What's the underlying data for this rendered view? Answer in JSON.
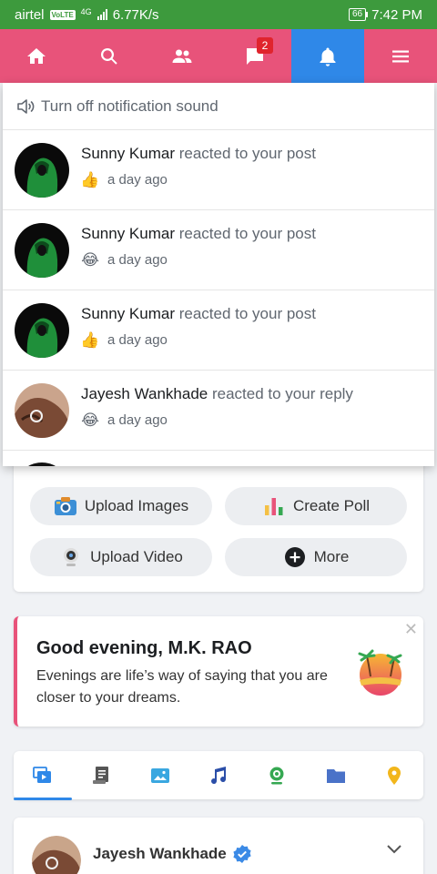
{
  "status_bar": {
    "carrier": "airtel",
    "volte": "VoLTE",
    "network": "4G",
    "speed": "6.77K/s",
    "battery": "66",
    "time": "7:42 PM"
  },
  "nav": {
    "items": [
      {
        "name": "home",
        "icon": "home-icon"
      },
      {
        "name": "search",
        "icon": "search-icon"
      },
      {
        "name": "friends",
        "icon": "friends-icon"
      },
      {
        "name": "messages",
        "icon": "chat-icon",
        "badge": "2"
      },
      {
        "name": "notifications",
        "icon": "bell-icon",
        "active": true
      },
      {
        "name": "menu",
        "icon": "menu-icon"
      }
    ],
    "colors": {
      "bar": "#e8537a",
      "active": "#2f88e8"
    }
  },
  "notifications": {
    "sound_toggle": "Turn off notification sound",
    "items": [
      {
        "actor": "Sunny Kumar",
        "action": "reacted to your post",
        "reaction": "like",
        "reaction_icon": "👍",
        "time": "a day ago"
      },
      {
        "actor": "Sunny Kumar",
        "action": "reacted to your post",
        "reaction": "haha",
        "reaction_icon": "😂",
        "time": "a day ago"
      },
      {
        "actor": "Sunny Kumar",
        "action": "reacted to your post",
        "reaction": "like",
        "reaction_icon": "👍",
        "time": "a day ago"
      },
      {
        "actor": "Jayesh Wankhade",
        "action": "reacted to your reply",
        "reaction": "haha",
        "reaction_icon": "😂",
        "time": "a day ago"
      }
    ]
  },
  "composer": {
    "upload_images": "Upload Images",
    "create_poll": "Create Poll",
    "upload_video": "Upload Video",
    "more": "More"
  },
  "greeting": {
    "title": "Good evening, M.K. RAO",
    "message": "Evenings are life’s way of saying that you are closer to your dreams.",
    "close_icon": "close-icon",
    "accent": "#e8537a"
  },
  "filter_tabs": [
    {
      "icon": "video-icon",
      "color": "#2f88e8",
      "active": true
    },
    {
      "icon": "article-icon",
      "color": "#555"
    },
    {
      "icon": "photo-icon",
      "color": "#3aa7e0"
    },
    {
      "icon": "music-icon",
      "color": "#2b4ea8"
    },
    {
      "icon": "webcam-icon",
      "color": "#36a852"
    },
    {
      "icon": "folder-icon",
      "color": "#4a72c8"
    },
    {
      "icon": "location-icon",
      "color": "#f2b61b"
    }
  ],
  "post": {
    "author": "Jayesh Wankhade",
    "verified": true
  }
}
